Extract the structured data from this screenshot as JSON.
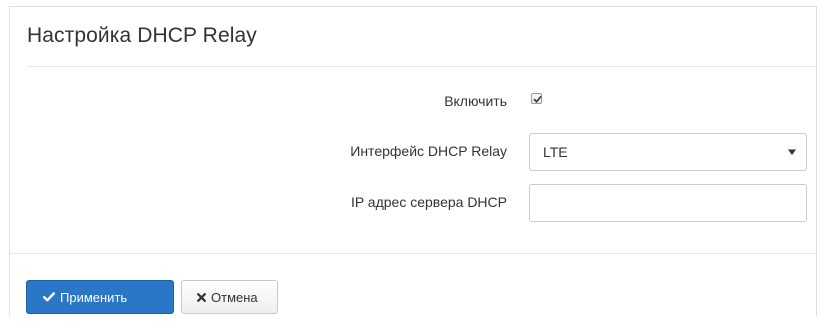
{
  "panel": {
    "title": "Настройка DHCP Relay"
  },
  "form": {
    "enable": {
      "label": "Включить",
      "checked": true
    },
    "interface": {
      "label": "Интерфейс DHCP Relay",
      "value": "LTE",
      "icon": "caret-down-icon"
    },
    "server_ip": {
      "label": "IP адрес сервера DHCP",
      "value": "",
      "placeholder": ""
    }
  },
  "actions": {
    "apply": {
      "label": "Применить",
      "icon": "check-icon",
      "color": "#2a77c7"
    },
    "cancel": {
      "label": "Отмена",
      "icon": "times-icon"
    }
  }
}
